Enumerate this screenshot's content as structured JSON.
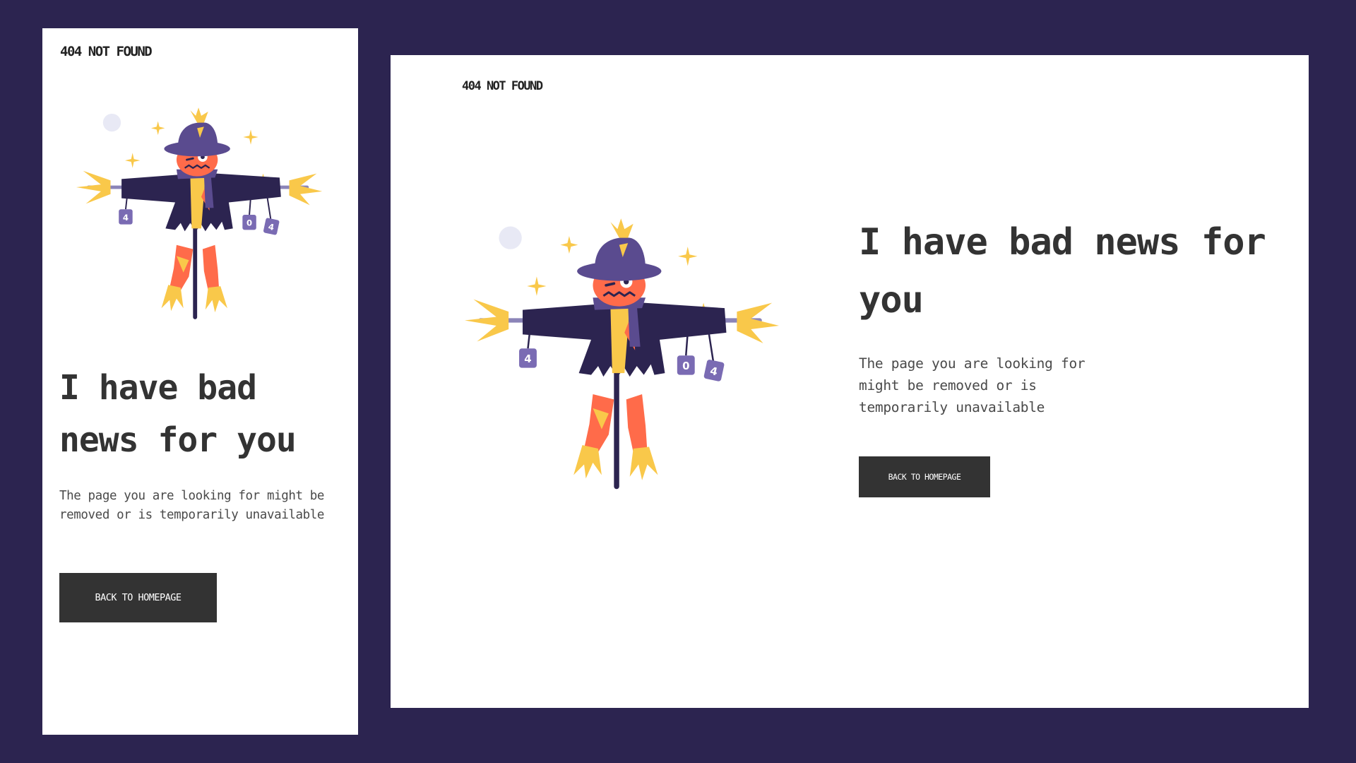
{
  "brand": "404 NOT FOUND",
  "heading": "I have bad news for you",
  "message": "The page you are looking for might be removed or is temporarily unavailable",
  "cta_label": "BACK TO HOMEPAGE",
  "illustration": {
    "icon": "scarecrow-illustration",
    "can_labels": [
      "4",
      "0",
      "4"
    ]
  },
  "colors": {
    "background": "#2c2450",
    "panel": "#ffffff",
    "text": "#333333",
    "button": "#333333",
    "scarecrow_coat": "#2c2450",
    "scarecrow_hat": "#5a4b8f",
    "scarecrow_face": "#ff6b4a",
    "straw": "#f9c84a",
    "cans": "#7a6bb3"
  }
}
